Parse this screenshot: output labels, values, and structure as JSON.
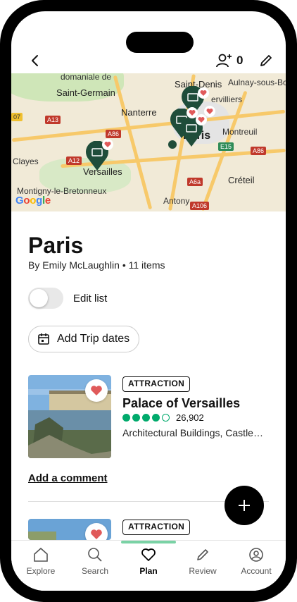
{
  "header": {
    "share_count": "0"
  },
  "map": {
    "labels": {
      "domaine": "domaniale de",
      "st_germain": "Saint-Germain",
      "nanterre": "Nanterre",
      "saint_denis": "Saint-Denis",
      "aulnay": "Aulnay-sous-Bo",
      "villiers": "ervilliers",
      "montreuil": "Montreuil",
      "paris": "Paris",
      "versailles": "Versailles",
      "clays": "Clayes",
      "creteil": "Créteil",
      "montigny": "Montigny-le-Bretonneux",
      "antony": "Antony",
      "google": "Google"
    },
    "road_signs": {
      "a13": "A13",
      "a86a": "A86",
      "a12": "A12",
      "a86b": "A86",
      "e15": "E15",
      "a6a": "A6a",
      "a106": "A106",
      "n7": "07"
    }
  },
  "list": {
    "title": "Paris",
    "byline": "By Emily McLaughlin • 11 items",
    "edit_label": "Edit list",
    "trip_dates_label": "Add Trip dates"
  },
  "items": [
    {
      "badge": "ATTRACTION",
      "title": "Palace of Versailles",
      "rating": 4,
      "review_count": "26,902",
      "category": "Architectural Buildings, Castle…",
      "comment_label": "Add a comment"
    },
    {
      "badge": "ATTRACTION"
    }
  ],
  "nav": [
    {
      "label": "Explore",
      "icon": "explore-icon"
    },
    {
      "label": "Search",
      "icon": "search-icon"
    },
    {
      "label": "Plan",
      "icon": "heart-icon",
      "active": true
    },
    {
      "label": "Review",
      "icon": "pencil-icon"
    },
    {
      "label": "Account",
      "icon": "account-icon"
    }
  ],
  "colors": {
    "accent": "#00aa6c",
    "pin": "#1f4d3a",
    "heart": "#e05a5a"
  }
}
